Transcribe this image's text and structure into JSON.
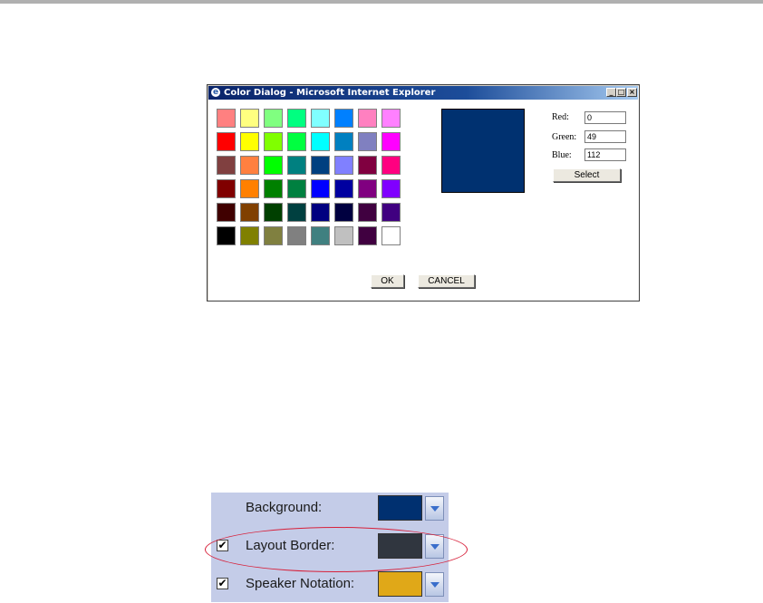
{
  "dialog": {
    "title": "Color Dialog - Microsoft Internet Explorer",
    "window_buttons": {
      "minimize": "_",
      "maximize": "□",
      "close": "×"
    },
    "palette": [
      [
        "#ff8080",
        "#ffff80",
        "#80ff80",
        "#00ff80",
        "#80ffff",
        "#0080ff",
        "#ff80c0",
        "#ff80ff"
      ],
      [
        "#ff0000",
        "#ffff00",
        "#80ff00",
        "#00ff40",
        "#00ffff",
        "#0080c0",
        "#8080c0",
        "#ff00ff"
      ],
      [
        "#804040",
        "#ff8040",
        "#00ff00",
        "#008080",
        "#004080",
        "#8080ff",
        "#800040",
        "#ff0080"
      ],
      [
        "#800000",
        "#ff8000",
        "#008000",
        "#008040",
        "#0000ff",
        "#0000a0",
        "#800080",
        "#8000ff"
      ],
      [
        "#400000",
        "#804000",
        "#004000",
        "#004040",
        "#000080",
        "#000040",
        "#400040",
        "#400080"
      ],
      [
        "#000000",
        "#808000",
        "#808040",
        "#808080",
        "#408080",
        "#c0c0c0",
        "#400040",
        "#ffffff"
      ]
    ],
    "preview_color": "#003170",
    "red_label": "Red:",
    "green_label": "Green:",
    "blue_label": "Blue:",
    "red_value": "0",
    "green_value": "49",
    "blue_value": "112",
    "select_label": "Select",
    "ok_label": "OK",
    "cancel_label": "CANCEL"
  },
  "settings": {
    "rows": [
      {
        "label": "Background:",
        "checkbox": false,
        "color": "#003070"
      },
      {
        "label": "Layout Border:",
        "checkbox": true,
        "color": "#30363f"
      },
      {
        "label": "Speaker Notation:",
        "checkbox": true,
        "color": "#e0a818"
      }
    ],
    "check_mark": "✔",
    "highlight_color": "#d7203a"
  }
}
